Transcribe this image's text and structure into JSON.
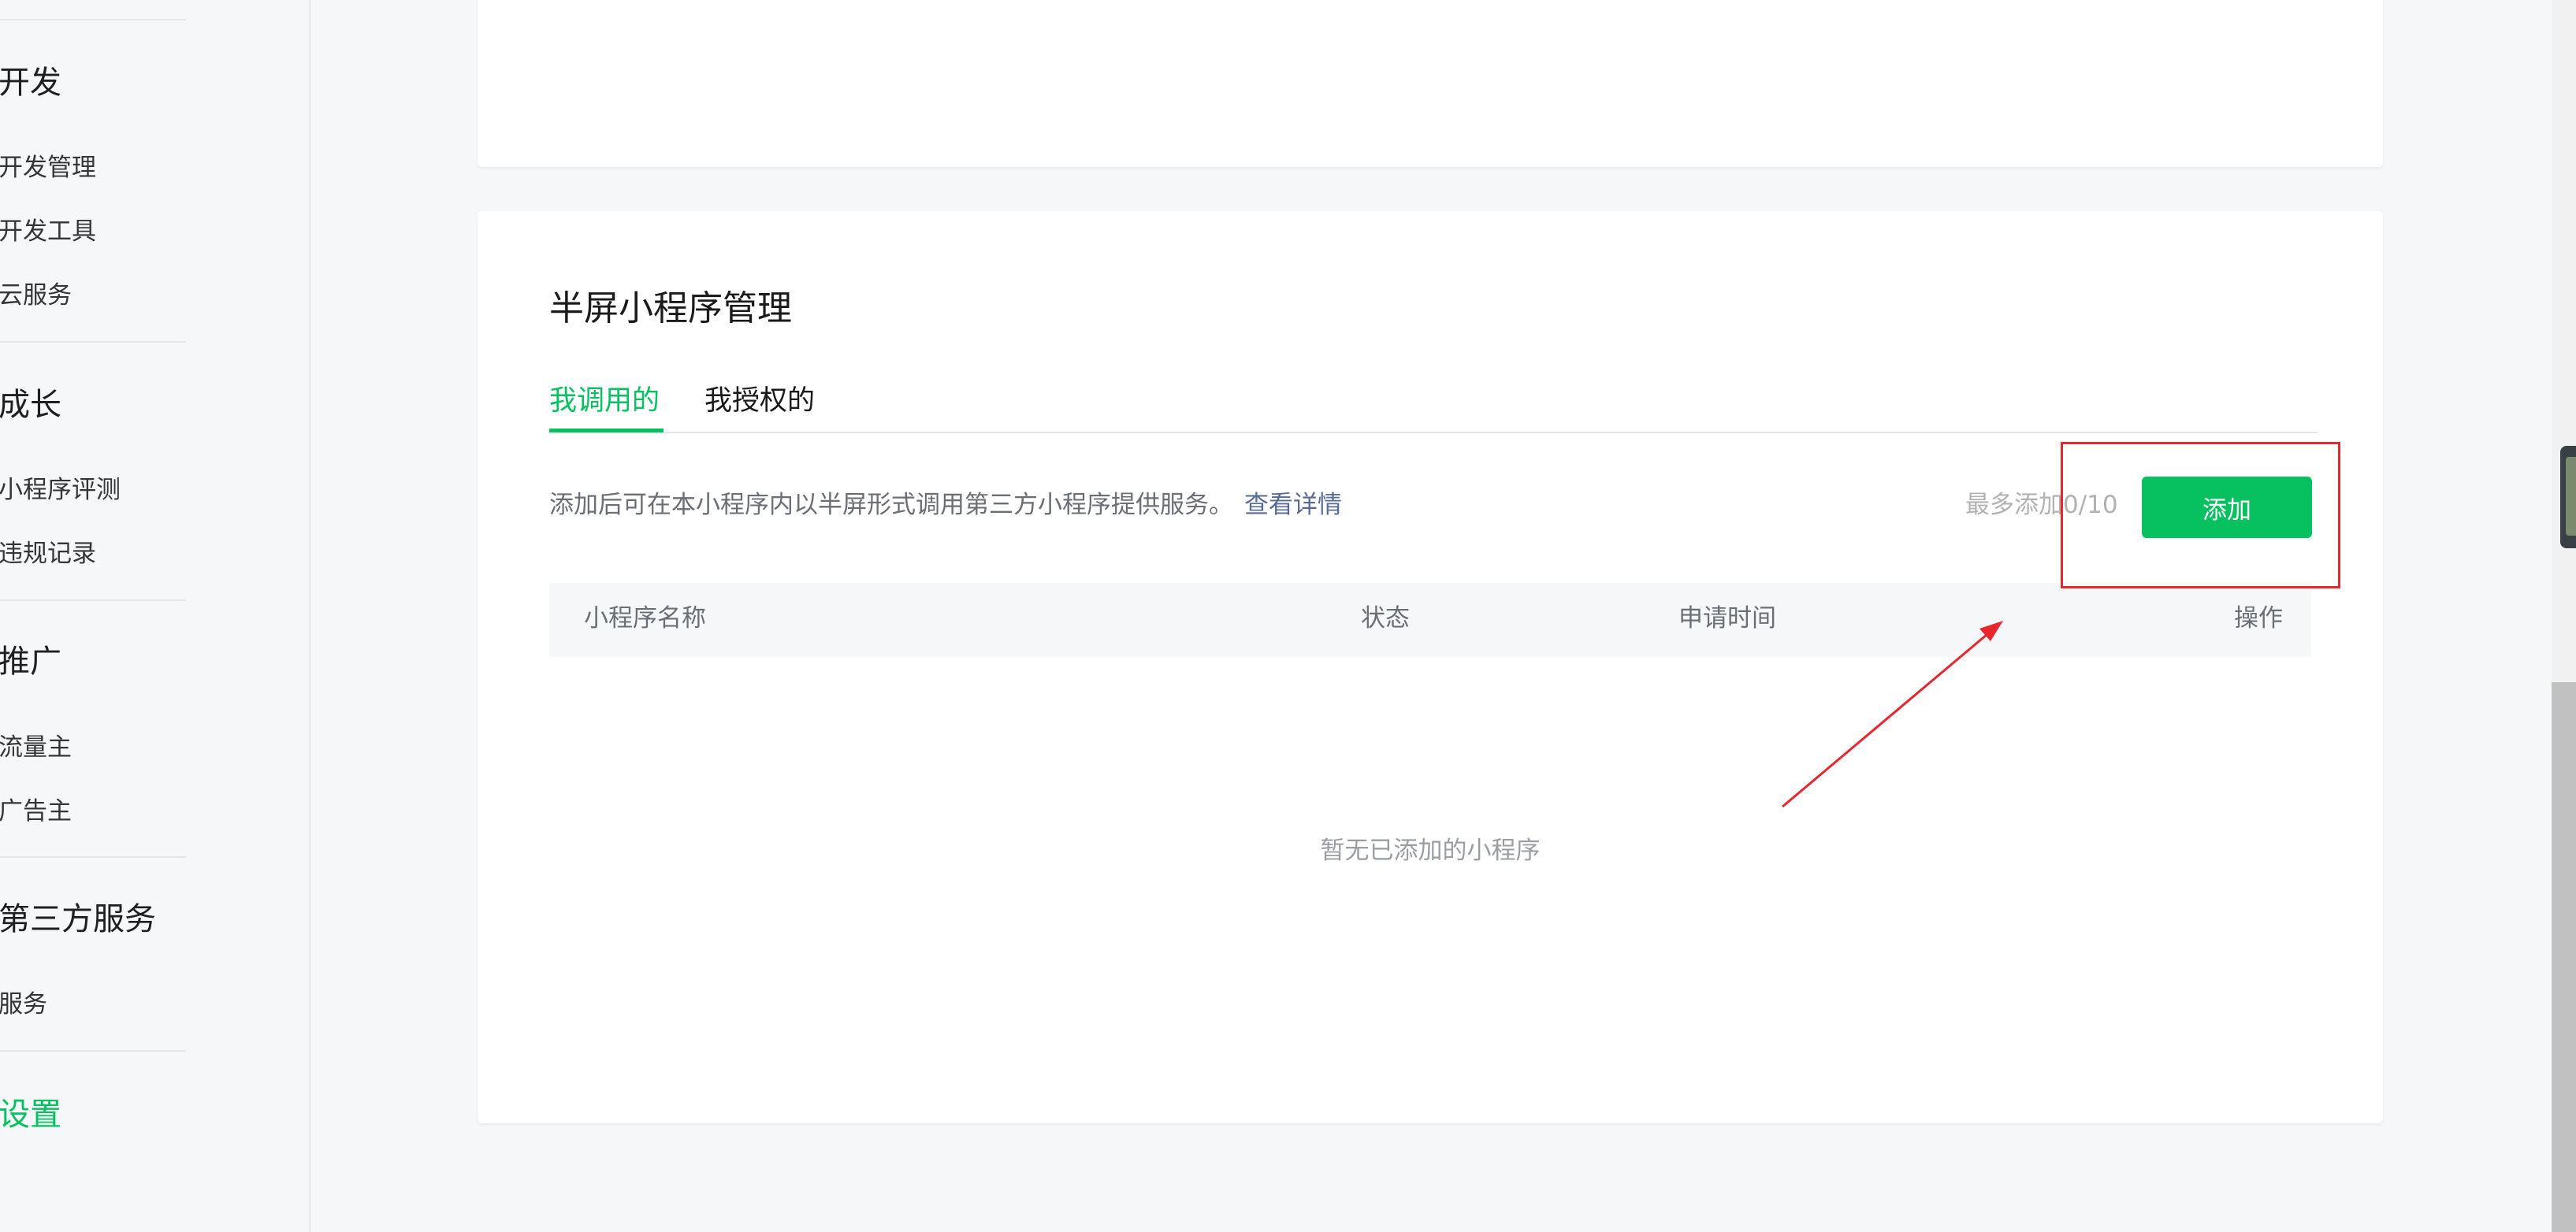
{
  "sidebar": {
    "groups": [
      {
        "label": "开发",
        "items": [
          "开发管理",
          "开发工具",
          "云服务"
        ]
      },
      {
        "label": "成长",
        "items": [
          "小程序评测",
          "违规记录"
        ]
      },
      {
        "label": "推广",
        "items": [
          "流量主",
          "广告主"
        ]
      },
      {
        "label": "第三方服务",
        "items": [
          "服务"
        ]
      }
    ],
    "active_item": "设置"
  },
  "card": {
    "title": "半屏小程序管理",
    "tabs": [
      {
        "label": "我调用的",
        "active": true
      },
      {
        "label": "我授权的",
        "active": false
      }
    ],
    "description": "添加后可在本小程序内以半屏形式调用第三方小程序提供服务。",
    "description_link": "查看详情",
    "limit_text": "最多添加0/10",
    "add_button": "添加",
    "table_headers": [
      "小程序名称",
      "状态",
      "申请时间",
      "操作"
    ],
    "empty_text": "暂无已添加的小程序"
  },
  "colors": {
    "accent": "#07c160",
    "link": "#576b95",
    "annotation": "#e8262e"
  }
}
